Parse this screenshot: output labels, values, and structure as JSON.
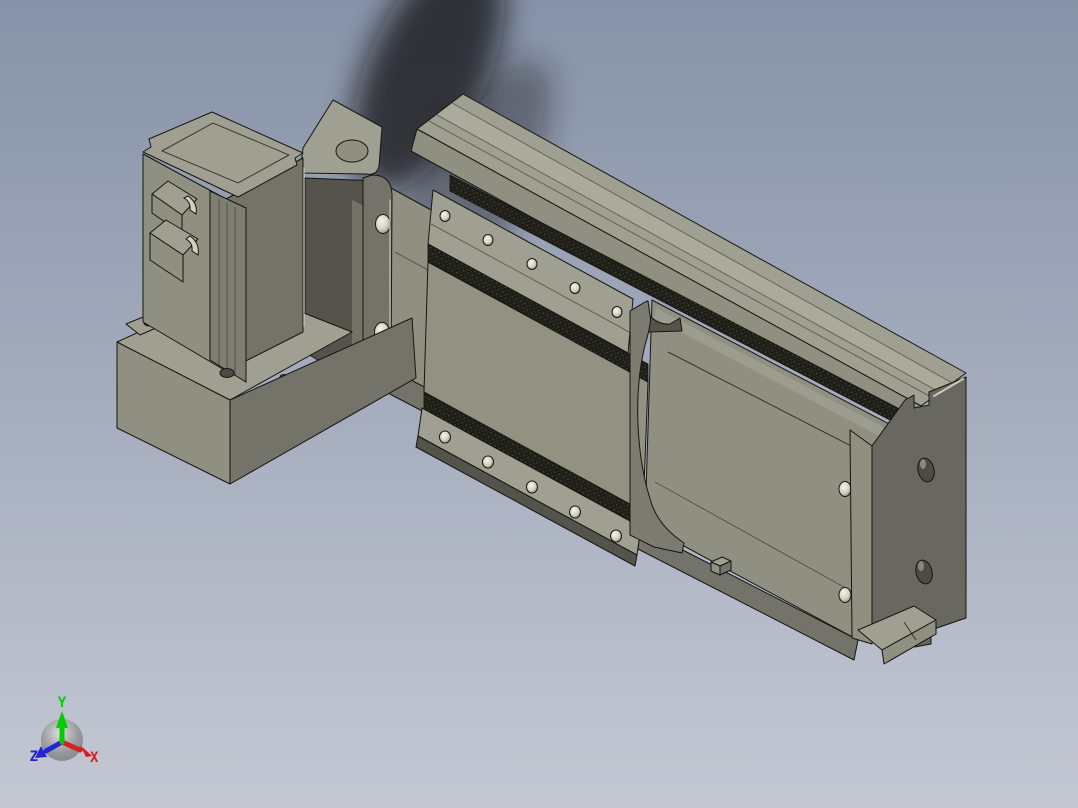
{
  "scene": {
    "type": "3d-cad-viewport",
    "view": "isometric",
    "subject": "linear actuator slide module with motor block",
    "parts": [
      {
        "id": "motor-block",
        "label": "motor block"
      },
      {
        "id": "connector-port-upper",
        "label": "upper connector port"
      },
      {
        "id": "connector-port-lower",
        "label": "lower connector port"
      },
      {
        "id": "motor-base",
        "label": "motor mounting base"
      },
      {
        "id": "motor-bracket",
        "label": "motor mount bracket"
      },
      {
        "id": "rail-body",
        "label": "guide rail body"
      },
      {
        "id": "rail-end-plate",
        "label": "rail left end plate"
      },
      {
        "id": "carriage",
        "label": "slider carriage"
      },
      {
        "id": "carriage-end-seal",
        "label": "carriage end seal strut"
      },
      {
        "id": "end-cap",
        "label": "rail end cap"
      }
    ]
  },
  "colors": {
    "bg-top": "#8792a8",
    "bg-bottom": "#c3c8d3",
    "body-light": "#a0a092",
    "body-mid": "#8f8f82",
    "body-face": "#929283",
    "body-dark": "#73736a",
    "body-deep": "#54544c",
    "end-cap": "#686860",
    "strip": "#1e1e18",
    "edge": "#16160f",
    "axis-x": "#d42020",
    "axis-y": "#00ce00",
    "axis-z": "#2424d4"
  },
  "triad": {
    "axes": [
      {
        "id": "x",
        "label": "X"
      },
      {
        "id": "y",
        "label": "Y"
      },
      {
        "id": "z",
        "label": "Z"
      }
    ]
  }
}
